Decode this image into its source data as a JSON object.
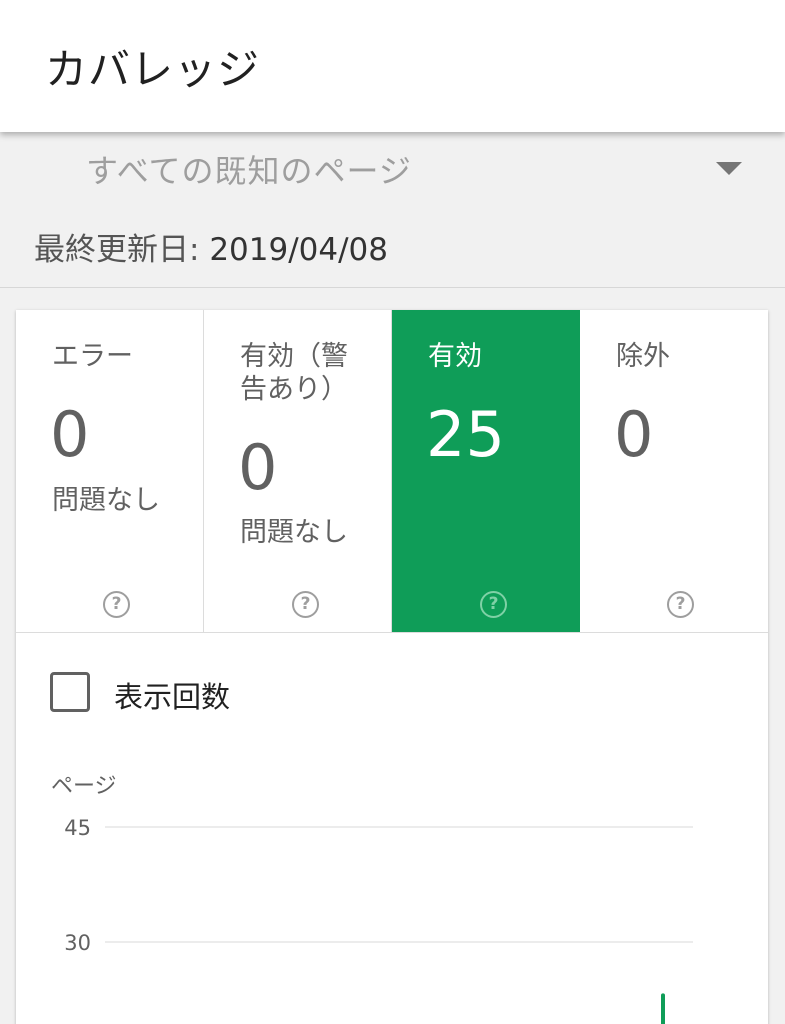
{
  "app_bar": {
    "title": "カバレッジ"
  },
  "filter": {
    "selected": "すべての既知のページ",
    "icon": "dropdown-arrow-icon"
  },
  "last_updated": {
    "label": "最終更新日:",
    "date": "2019/04/08"
  },
  "status_tiles": [
    {
      "label": "エラー",
      "count": "0",
      "sub": "問題なし",
      "help_icon": "help-circle-icon"
    },
    {
      "label": "有効（警告あり）",
      "count": "0",
      "sub": "問題なし",
      "help_icon": "help-circle-icon"
    },
    {
      "label": "有効",
      "count": "25",
      "sub": "",
      "help_icon": "help-circle-icon",
      "selected": true
    },
    {
      "label": "除外",
      "count": "0",
      "sub": "",
      "help_icon": "help-circle-icon"
    }
  ],
  "impressions_toggle": {
    "label": "表示回数",
    "checked": false
  },
  "colors": {
    "selected_tile": "#0f9d58",
    "chart_line": "#0f9d58",
    "grid": "#e6e6e6"
  },
  "chart_data": {
    "type": "line",
    "ylabel": "ページ",
    "yticks": [
      45,
      30
    ],
    "series": [
      {
        "values": [
          25
        ]
      }
    ]
  }
}
